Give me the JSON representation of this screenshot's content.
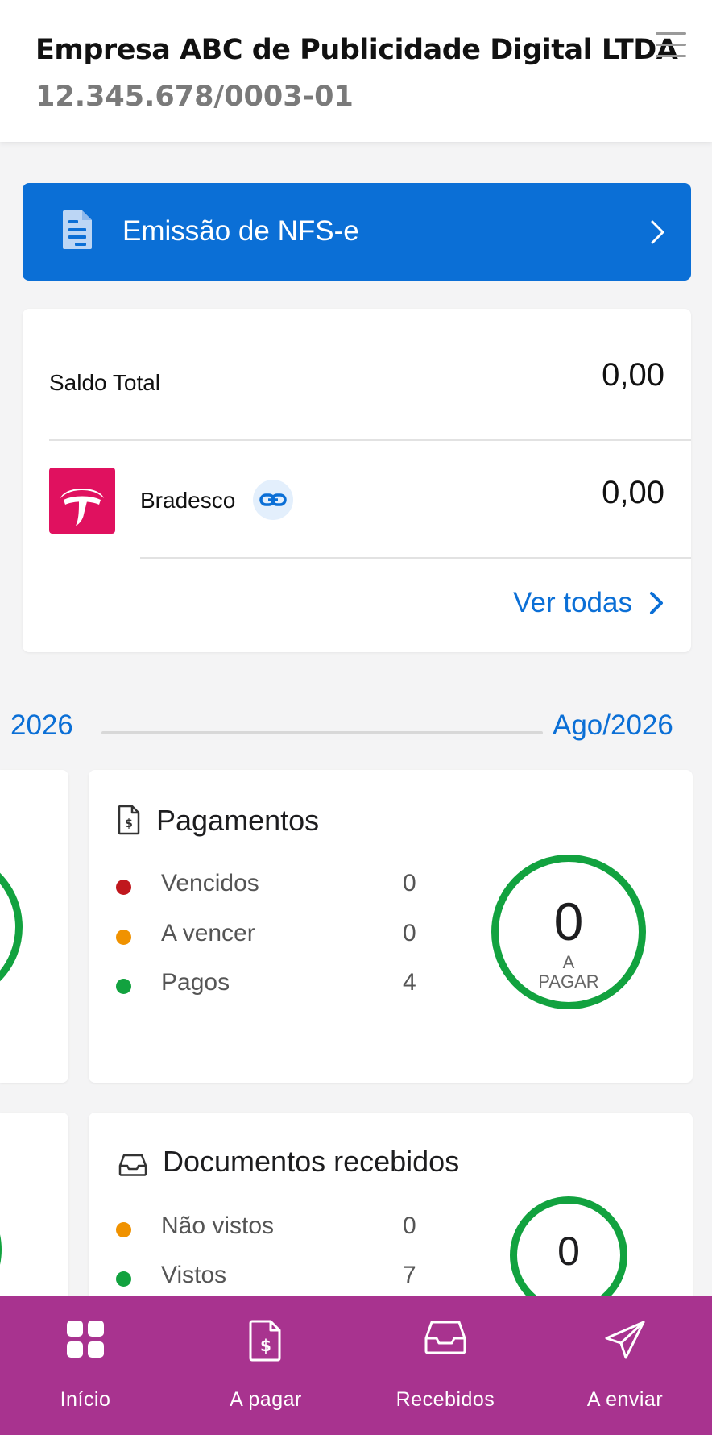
{
  "header": {
    "company_name": "Empresa ABC de Publicidade Digital LTDA",
    "cnpj": "12.345.678/0003-01"
  },
  "nfse": {
    "label": "Emissão de NFS-e"
  },
  "balance": {
    "total_label": "Saldo Total",
    "total_value": "0,00",
    "bank_name": "Bradesco",
    "bank_value": "0,00",
    "see_all_label": "Ver todas"
  },
  "period": {
    "left_label": "2026",
    "right_label": "Ago/2026"
  },
  "payments": {
    "title": "Pagamentos",
    "rows": [
      {
        "label": "Vencidos",
        "count": "0",
        "color": "#c0171d"
      },
      {
        "label": "A vencer",
        "count": "0",
        "color": "#f09200"
      },
      {
        "label": "Pagos",
        "count": "4",
        "color": "#12a23f"
      }
    ],
    "ring_value": "0",
    "ring_caption_1": "A",
    "ring_caption_2": "PAGAR"
  },
  "documents": {
    "title": "Documentos recebidos",
    "rows": [
      {
        "label": "Não vistos",
        "count": "0",
        "color": "#f09200"
      },
      {
        "label": "Vistos",
        "count": "7",
        "color": "#12a23f"
      }
    ],
    "ring_value": "0"
  },
  "bottom_nav": [
    {
      "label": "Início",
      "icon": "grid-icon"
    },
    {
      "label": "A pagar",
      "icon": "invoice-dollar-icon"
    },
    {
      "label": "Recebidos",
      "icon": "inbox-icon"
    },
    {
      "label": "A enviar",
      "icon": "send-icon"
    }
  ],
  "colors": {
    "accent_blue": "#0b6fd6",
    "nav_purple": "#a8338f",
    "ring_green": "#12a23f",
    "bradesco_red": "#e0115f"
  }
}
